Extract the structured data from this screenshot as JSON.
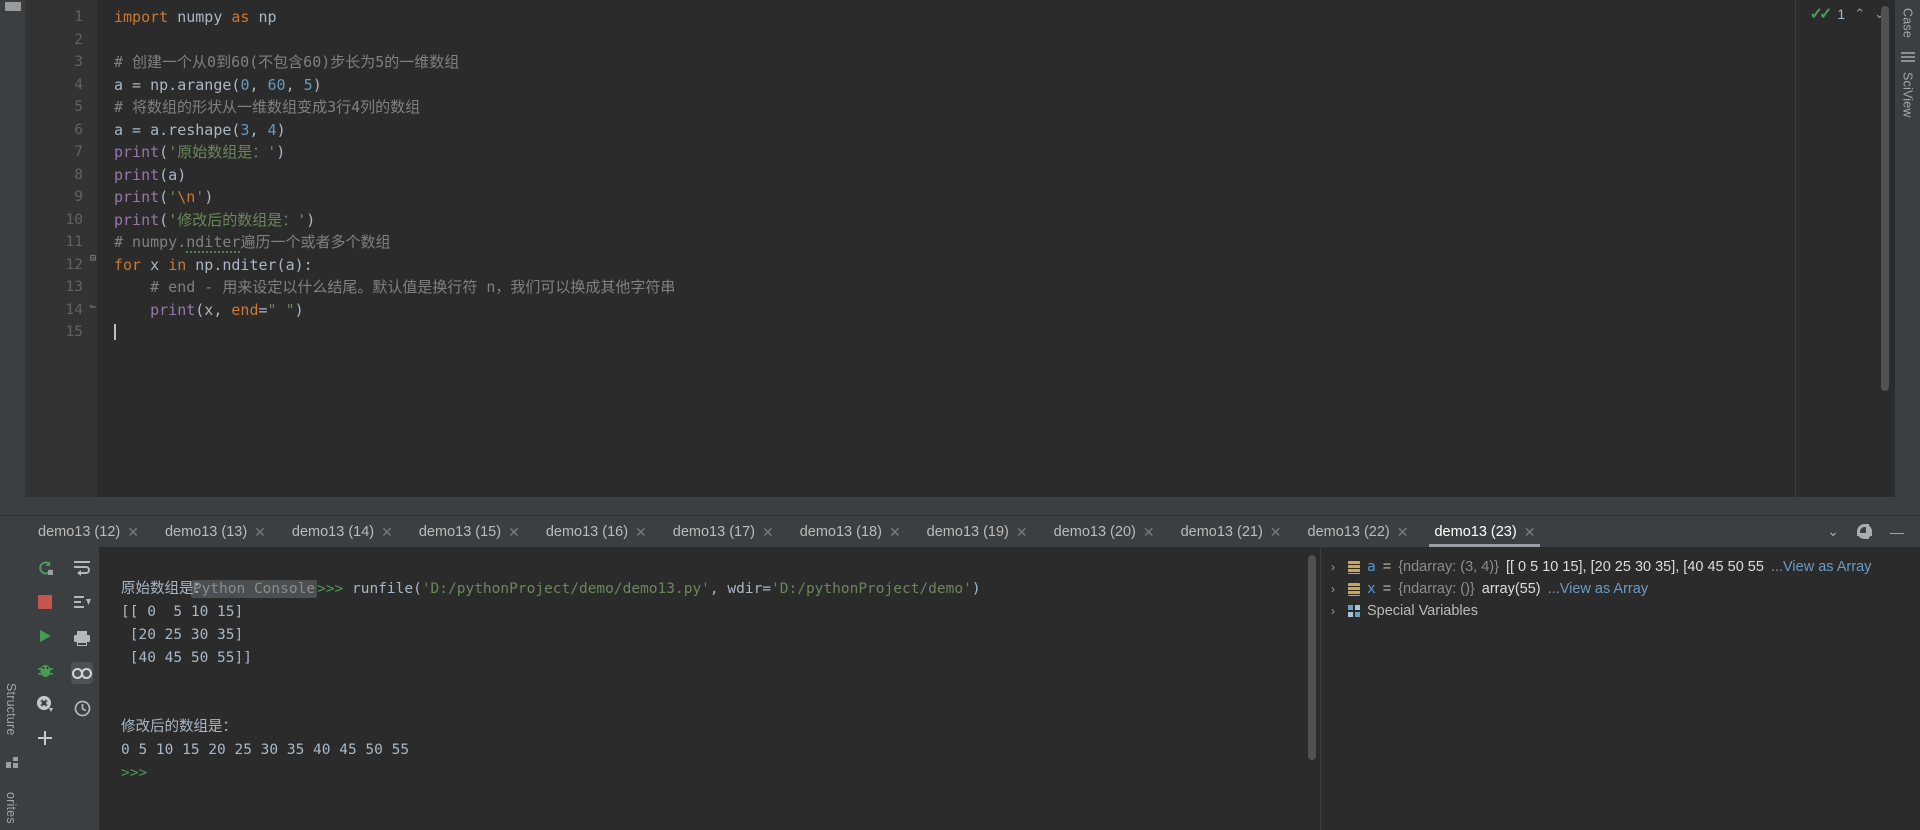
{
  "editor": {
    "lines": [
      {
        "n": "1",
        "tokens": [
          {
            "t": "import",
            "c": "kw"
          },
          {
            "t": " numpy ",
            "c": "ident"
          },
          {
            "t": "as",
            "c": "kw"
          },
          {
            "t": " np",
            "c": "ident"
          }
        ]
      },
      {
        "n": "2",
        "tokens": []
      },
      {
        "n": "3",
        "tokens": [
          {
            "t": "# 创建一个从0到60(不包含60)步长为5的一维数组",
            "c": "cmt"
          }
        ]
      },
      {
        "n": "4",
        "tokens": [
          {
            "t": "a = np.arange(",
            "c": "ident"
          },
          {
            "t": "0",
            "c": "num"
          },
          {
            "t": ", ",
            "c": "ident"
          },
          {
            "t": "60",
            "c": "num"
          },
          {
            "t": ", ",
            "c": "ident"
          },
          {
            "t": "5",
            "c": "num"
          },
          {
            "t": ")",
            "c": "ident"
          }
        ]
      },
      {
        "n": "5",
        "tokens": [
          {
            "t": "# 将数组的形状从一维数组变成3行4列的数组",
            "c": "cmt"
          }
        ]
      },
      {
        "n": "6",
        "tokens": [
          {
            "t": "a = a.reshape(",
            "c": "ident"
          },
          {
            "t": "3",
            "c": "num"
          },
          {
            "t": ", ",
            "c": "ident"
          },
          {
            "t": "4",
            "c": "num"
          },
          {
            "t": ")",
            "c": "ident"
          }
        ]
      },
      {
        "n": "7",
        "tokens": [
          {
            "t": "print",
            "c": "vio"
          },
          {
            "t": "(",
            "c": "ident"
          },
          {
            "t": "'原始数组是：'",
            "c": "str"
          },
          {
            "t": ")",
            "c": "ident"
          }
        ]
      },
      {
        "n": "8",
        "tokens": [
          {
            "t": "print",
            "c": "vio"
          },
          {
            "t": "(a)",
            "c": "ident"
          }
        ]
      },
      {
        "n": "9",
        "tokens": [
          {
            "t": "print",
            "c": "vio"
          },
          {
            "t": "(",
            "c": "ident"
          },
          {
            "t": "'",
            "c": "str"
          },
          {
            "t": "\\n",
            "c": "esc"
          },
          {
            "t": "'",
            "c": "str"
          },
          {
            "t": ")",
            "c": "ident"
          }
        ]
      },
      {
        "n": "10",
        "tokens": [
          {
            "t": "print",
            "c": "vio"
          },
          {
            "t": "(",
            "c": "ident"
          },
          {
            "t": "'修改后的数组是：'",
            "c": "str"
          },
          {
            "t": ")",
            "c": "ident"
          }
        ]
      },
      {
        "n": "11",
        "tokens": [
          {
            "t": "# numpy.",
            "c": "cmt"
          },
          {
            "t": "nditer",
            "c": "cmt squig"
          },
          {
            "t": "遍历一个或者多个数组",
            "c": "cmt"
          }
        ]
      },
      {
        "n": "12",
        "tokens": [
          {
            "t": "for",
            "c": "kw"
          },
          {
            "t": " x ",
            "c": "ident"
          },
          {
            "t": "in",
            "c": "kw"
          },
          {
            "t": " np.nditer(a):",
            "c": "ident"
          }
        ],
        "fold": "minus"
      },
      {
        "n": "13",
        "tokens": [
          {
            "t": "    # end - 用来设定以什么结尾。默认值是换行符 n，我们可以换成其他字符串",
            "c": "cmt"
          }
        ]
      },
      {
        "n": "14",
        "tokens": [
          {
            "t": "    ",
            "c": "ident"
          },
          {
            "t": "print",
            "c": "vio"
          },
          {
            "t": "(x, ",
            "c": "ident"
          },
          {
            "t": "end",
            "c": "kw"
          },
          {
            "t": "=",
            "c": "ident"
          },
          {
            "t": "\" \"",
            "c": "str"
          },
          {
            "t": ")",
            "c": "ident"
          }
        ],
        "fold": "end"
      },
      {
        "n": "15",
        "tokens": [],
        "caret": true
      }
    ],
    "inspection_count": "1",
    "inspection_up": "⌃",
    "inspection_down": "⌄"
  },
  "right_rail": {
    "database_label": "Case",
    "sciview_label": "SciView"
  },
  "left_rail": {
    "structure_label": "Structure",
    "favorites_label": "orites"
  },
  "tabbar": {
    "tabs": [
      {
        "label": "demo13 (12)",
        "active": false
      },
      {
        "label": "demo13 (13)",
        "active": false
      },
      {
        "label": "demo13 (14)",
        "active": false
      },
      {
        "label": "demo13 (15)",
        "active": false
      },
      {
        "label": "demo13 (16)",
        "active": false
      },
      {
        "label": "demo13 (17)",
        "active": false
      },
      {
        "label": "demo13 (18)",
        "active": false
      },
      {
        "label": "demo13 (19)",
        "active": false
      },
      {
        "label": "demo13 (20)",
        "active": false
      },
      {
        "label": "demo13 (21)",
        "active": false
      },
      {
        "label": "demo13 (22)",
        "active": false
      },
      {
        "label": "demo13 (23)",
        "active": true
      }
    ],
    "close_glyph": "✕",
    "dropdown_glyph": "⌄",
    "minimize_glyph": "—"
  },
  "run_toolbar": {
    "rerun": "rerun-icon",
    "stop": "stop-icon",
    "run": "run-icon",
    "debug": "debug-icon",
    "settings": "settings-icon",
    "add": "add-icon"
  },
  "console": {
    "label": "Python Console",
    "prompt": ">>> ",
    "command_prefix": "runfile(",
    "command_arg1": "'D:/pythonProject/demo/demo13.py'",
    "command_sep": ", wdir=",
    "command_arg2": "'D:/pythonProject/demo'",
    "command_suffix": ")",
    "out_line1": "原始数组是：",
    "out_line2": "[[ 0  5 10 15]",
    "out_line3": " [20 25 30 35]",
    "out_line4": " [40 45 50 55]]",
    "out_line5": "",
    "out_line6": "",
    "out_line7": "修改后的数组是：",
    "out_line8": "0 5 10 15 20 25 30 35 40 45 50 55",
    "out_prompt": ">>>"
  },
  "variables": [
    {
      "icon": "ndarray-icon",
      "name": "a",
      "eq": " = ",
      "type": "{ndarray: (3, 4)}",
      "value": " [[ 0  5 10 15], [20 25 30 35], [40 45 50 55",
      "link": "...View as Array"
    },
    {
      "icon": "ndarray-icon",
      "name": "x",
      "eq": " = ",
      "type": "{ndarray: ()}",
      "value": " array(55)",
      "link": "...View as Array"
    }
  ],
  "special_variables_label": "Special Variables",
  "colors": {
    "background": "#2b2b2b",
    "panel": "#3c3f41",
    "gutter": "#313335",
    "keyword": "#cc7832",
    "string": "#6a8759",
    "number": "#6897bb",
    "comment": "#808080",
    "function": "#ffc66d",
    "builtin": "#9876aa",
    "accent_green": "#499c54",
    "link": "#6a9bc3"
  }
}
